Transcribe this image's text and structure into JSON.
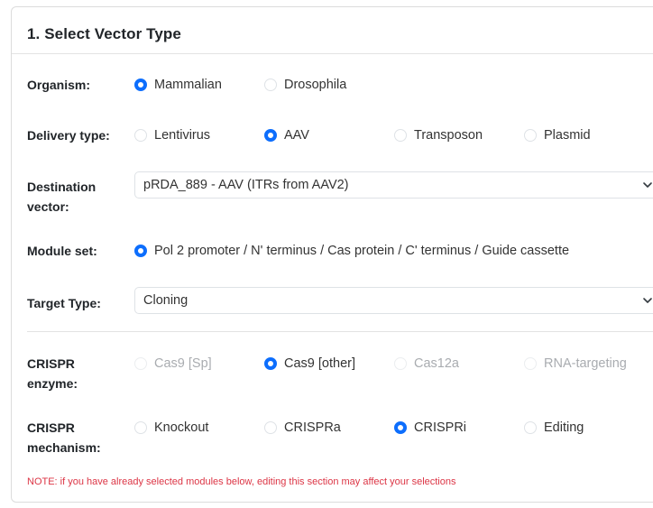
{
  "card": {
    "title": "1. Select Vector Type"
  },
  "organism": {
    "label": "Organism:",
    "options": [
      {
        "label": "Mammalian",
        "checked": true,
        "disabled": false
      },
      {
        "label": "Drosophila",
        "checked": false,
        "disabled": false
      }
    ]
  },
  "delivery": {
    "label": "Delivery type:",
    "options": [
      {
        "label": "Lentivirus",
        "checked": false,
        "disabled": false
      },
      {
        "label": "AAV",
        "checked": true,
        "disabled": false
      },
      {
        "label": "Transposon",
        "checked": false,
        "disabled": false
      },
      {
        "label": "Plasmid",
        "checked": false,
        "disabled": false
      }
    ]
  },
  "destination": {
    "label_line1": "Destination",
    "label_line2": "vector:",
    "selected": "pRDA_889 - AAV (ITRs from AAV2)"
  },
  "module_set": {
    "label": "Module set:",
    "options": [
      {
        "label": "Pol 2 promoter / N' terminus / Cas protein / C' terminus / Guide cassette",
        "checked": true,
        "disabled": false
      }
    ]
  },
  "target_type": {
    "label": "Target Type:",
    "selected": "Cloning"
  },
  "enzyme": {
    "label_line1": "CRISPR",
    "label_line2": "enzyme:",
    "options": [
      {
        "label": "Cas9 [Sp]",
        "checked": false,
        "disabled": true
      },
      {
        "label": "Cas9 [other]",
        "checked": true,
        "disabled": false
      },
      {
        "label": "Cas12a",
        "checked": false,
        "disabled": true
      },
      {
        "label": "RNA-targeting",
        "checked": false,
        "disabled": true
      }
    ]
  },
  "mechanism": {
    "label_line1": "CRISPR",
    "label_line2": "mechanism:",
    "options": [
      {
        "label": "Knockout",
        "checked": false,
        "disabled": false
      },
      {
        "label": "CRISPRa",
        "checked": false,
        "disabled": false
      },
      {
        "label": "CRISPRi",
        "checked": true,
        "disabled": false
      },
      {
        "label": "Editing",
        "checked": false,
        "disabled": false
      }
    ]
  },
  "note": "NOTE: if you have already selected modules below, editing this section may affect your selections",
  "colors": {
    "accent": "#0d6efd",
    "note": "#dc3545"
  }
}
